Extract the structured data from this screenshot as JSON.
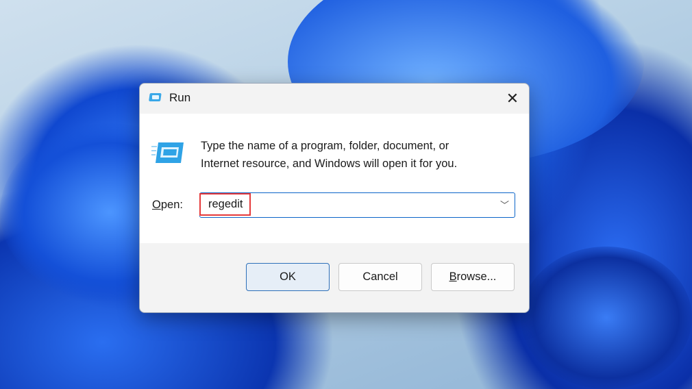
{
  "dialog": {
    "title": "Run",
    "description_line1": "Type the name of a program, folder, document, or",
    "description_line2": "Internet resource, and Windows will open it for you.",
    "open_label_accel": "O",
    "open_label_rest": "pen:",
    "open_value": "regedit",
    "buttons": {
      "ok": "OK",
      "cancel": "Cancel",
      "browse_accel": "B",
      "browse_rest": "rowse..."
    }
  },
  "colors": {
    "accent": "#0a64c8",
    "highlight": "#e5393a"
  }
}
